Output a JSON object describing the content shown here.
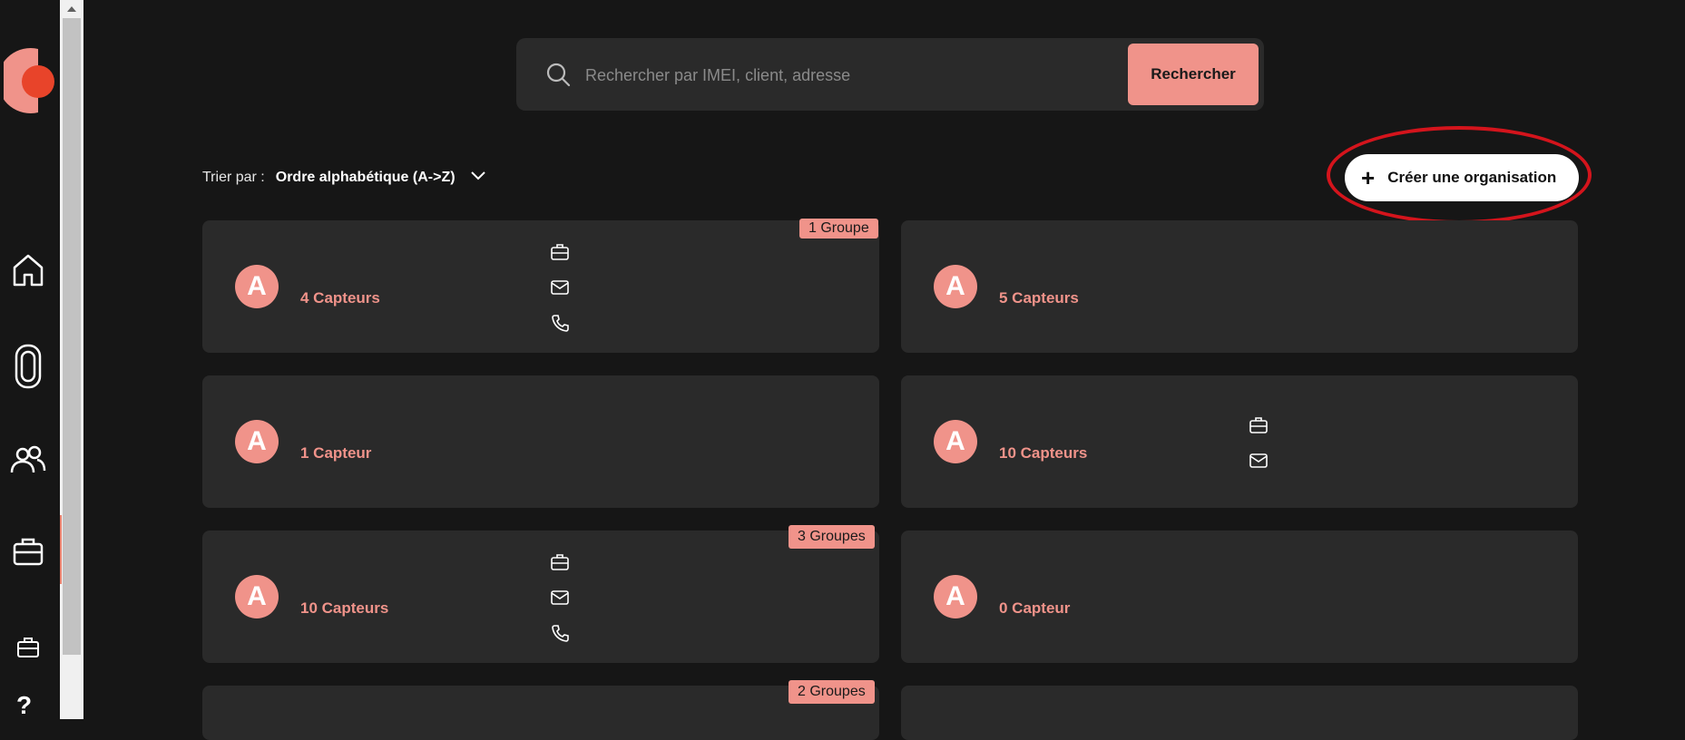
{
  "search": {
    "placeholder": "Rechercher par IMEI, client, adresse",
    "button_label": "Rechercher"
  },
  "sort": {
    "label": "Trier par :",
    "value": "Ordre alphabétique (A->Z)"
  },
  "create_button_label": "Créer une organisation",
  "help_label": "?",
  "colors": {
    "accent": "#f0938a",
    "background": "#161616",
    "card": "#2a2a2a",
    "highlight_ring": "#d4141c"
  },
  "sidebar": {
    "items": [
      "home-icon",
      "sensor-icon",
      "users-icon",
      "briefcase-icon",
      "briefcase-small-icon",
      "help-icon"
    ]
  },
  "cards": [
    {
      "avatar": "A",
      "count": "4 Capteurs",
      "badge": "1 Groupe",
      "contacts": [
        "briefcase-icon",
        "mail-icon",
        "phone-icon"
      ]
    },
    {
      "avatar": "A",
      "count": "5 Capteurs",
      "badge": "",
      "contacts": []
    },
    {
      "avatar": "A",
      "count": "1 Capteur",
      "badge": "",
      "contacts": []
    },
    {
      "avatar": "A",
      "count": "10 Capteurs",
      "badge": "",
      "contacts": [
        "briefcase-icon",
        "mail-icon"
      ]
    },
    {
      "avatar": "A",
      "count": "10 Capteurs",
      "badge": "3 Groupes",
      "contacts": [
        "briefcase-icon",
        "mail-icon",
        "phone-icon"
      ]
    },
    {
      "avatar": "A",
      "count": "0 Capteur",
      "badge": "",
      "contacts": []
    },
    {
      "avatar": "",
      "count": "",
      "badge": "2 Groupes",
      "contacts": []
    },
    {
      "avatar": "",
      "count": "",
      "badge": "",
      "contacts": []
    }
  ]
}
